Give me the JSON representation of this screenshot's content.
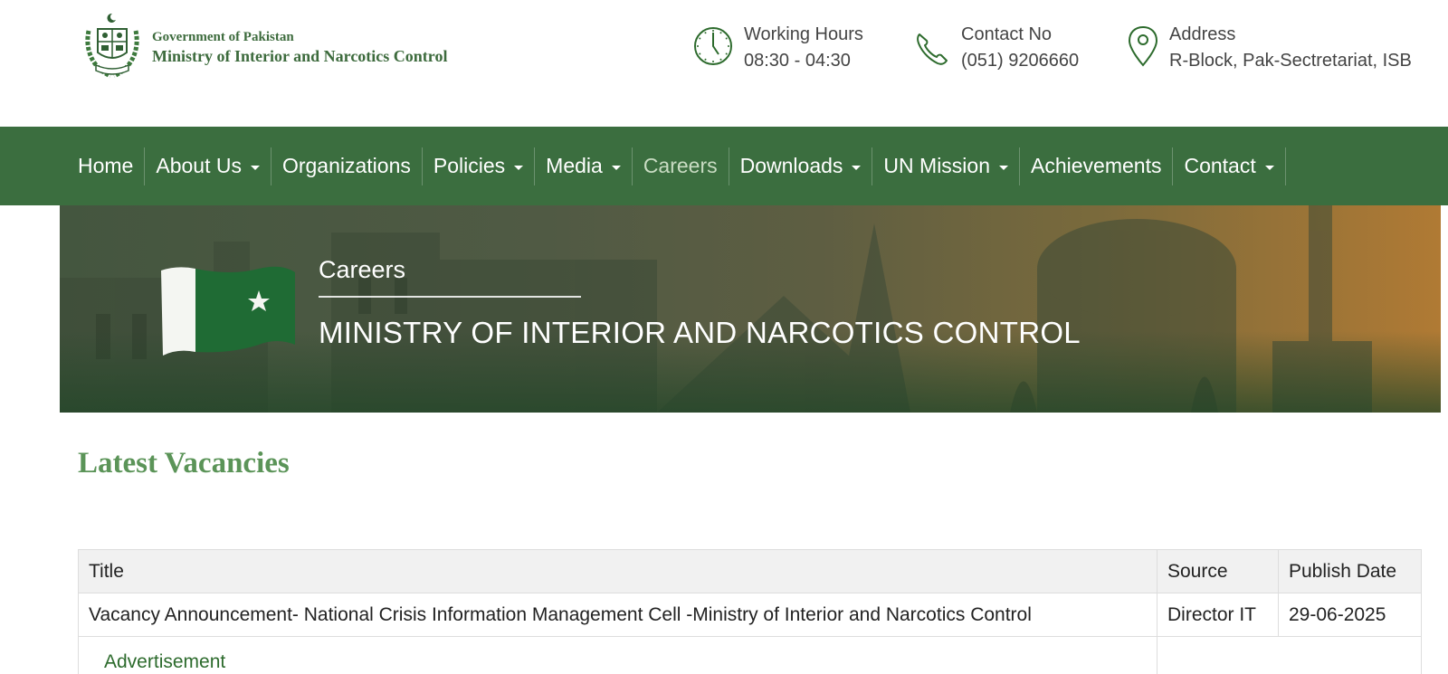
{
  "header": {
    "logo_line1": "Government of Pakistan",
    "logo_line2": "Ministry of Interior and Narcotics Control",
    "working_hours": {
      "label": "Working Hours",
      "value": "08:30 - 04:30",
      "icon": "clock-icon"
    },
    "contact": {
      "label": "Contact No",
      "value": "(051) 9206660",
      "icon": "phone-icon"
    },
    "address": {
      "label": "Address",
      "value": "R-Block, Pak-Sectretariat, ISB",
      "icon": "map-pin-icon"
    }
  },
  "nav": {
    "items": [
      {
        "label": "Home",
        "dropdown": false
      },
      {
        "label": "About Us",
        "dropdown": true
      },
      {
        "label": "Organizations",
        "dropdown": false
      },
      {
        "label": "Policies",
        "dropdown": true
      },
      {
        "label": "Media",
        "dropdown": true
      },
      {
        "label": "Careers",
        "dropdown": false,
        "active": true
      },
      {
        "label": "Downloads",
        "dropdown": true
      },
      {
        "label": "UN Mission",
        "dropdown": true
      },
      {
        "label": "Achievements",
        "dropdown": false
      },
      {
        "label": "Contact",
        "dropdown": true
      }
    ]
  },
  "banner": {
    "subtitle": "Careers",
    "title": "MINISTRY OF INTERIOR AND NARCOTICS CONTROL"
  },
  "content": {
    "heading": "Latest Vacancies",
    "table": {
      "headers": [
        "Title",
        "Source",
        "Publish Date"
      ],
      "rows": [
        {
          "title": "Vacancy Announcement- National Crisis Information Management Cell -Ministry of Interior and Narcotics Control",
          "source": "Director IT",
          "date": "29-06-2025",
          "attachment": "Advertisement"
        }
      ]
    }
  },
  "colors": {
    "brand_green": "#3b6e3f",
    "heading_green": "#5b9458",
    "link_green": "#2d6b2d"
  }
}
